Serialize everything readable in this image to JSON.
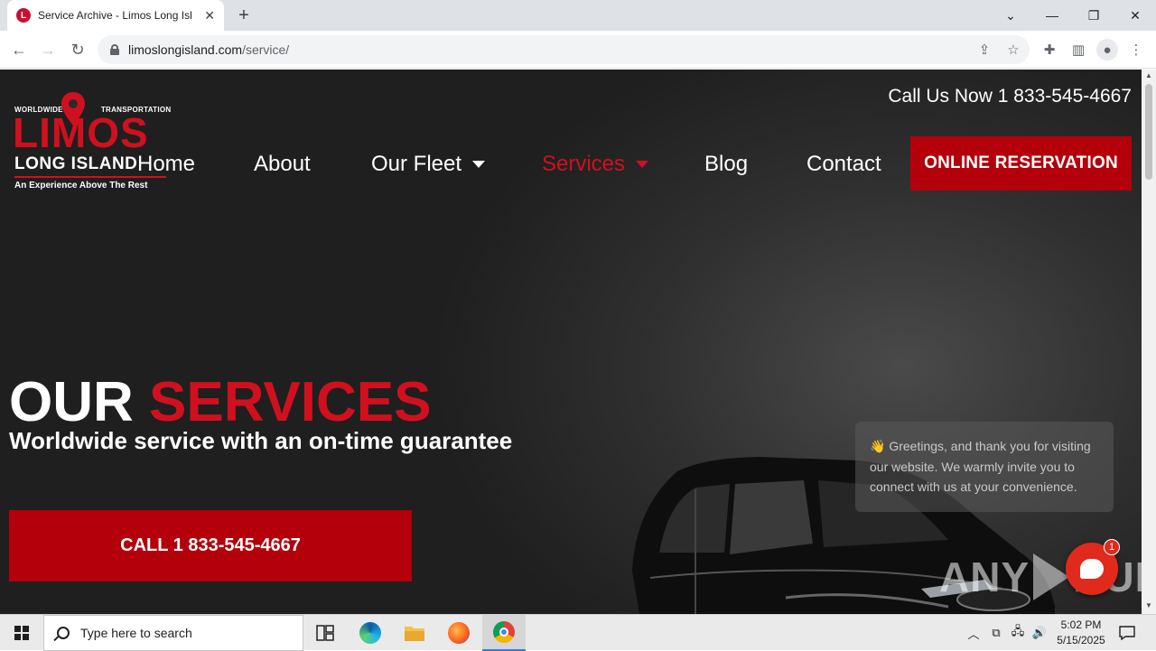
{
  "browser": {
    "tab_title": "Service Archive - Limos Long Isl",
    "favicon_letter": "L",
    "url_host": "limoslongisland.com",
    "url_path": "/service/"
  },
  "site": {
    "logo": {
      "top_left": "WORLDWIDE",
      "top_right": "TRANSPORTATION",
      "brand": "LIMOS",
      "brand_sub": "LONG ISLAND",
      "tagline": "An Experience Above The Rest"
    },
    "call_now": "Call Us Now 1 833-545-4667",
    "nav": [
      {
        "label": "Home"
      },
      {
        "label": "About"
      },
      {
        "label": "Our Fleet"
      },
      {
        "label": "Services"
      },
      {
        "label": "Blog"
      },
      {
        "label": "Contact"
      }
    ],
    "reserve_button": "ONLINE RESERVATION",
    "hero": {
      "title_white": "OUR",
      "title_red": "SERVICES",
      "subtitle": "Worldwide service with an on-time guarantee",
      "cta": "CALL 1 833-545-4667"
    },
    "chat": {
      "greeting": "Greetings, and thank you for visiting our website. We warmly invite you to connect with us at your convenience.",
      "badge_count": "1"
    },
    "watermark_left": "ANY",
    "watermark_right": "RUN"
  },
  "taskbar": {
    "search_placeholder": "Type here to search",
    "time": "5:02 PM",
    "date": "5/15/2025"
  },
  "colors": {
    "brand_red": "#d0101e",
    "button_red": "#b3000b"
  }
}
